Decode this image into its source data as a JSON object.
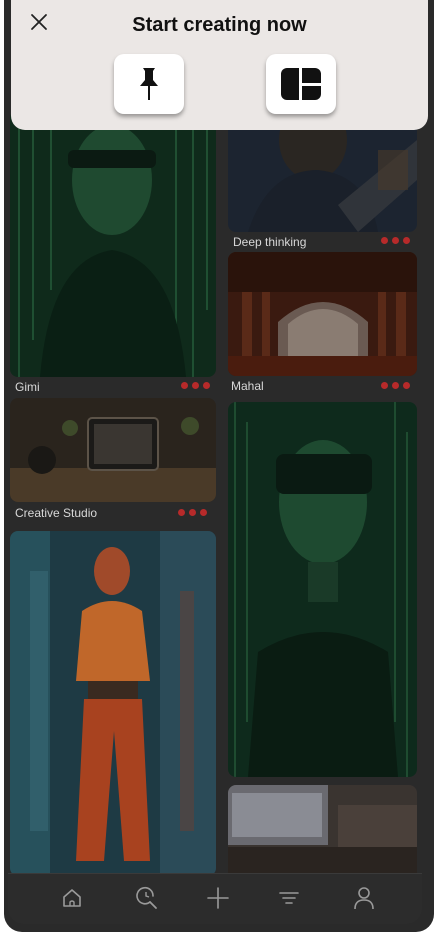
{
  "sheet": {
    "title": "Start creating now",
    "options": [
      {
        "icon": "pin-icon"
      },
      {
        "icon": "board-layout-icon"
      }
    ]
  },
  "feed": {
    "cards": [
      {
        "caption": "Gimi"
      },
      {
        "caption": "Creative Studio"
      },
      {
        "caption": "Deep thinking"
      },
      {
        "caption": "Mahal"
      }
    ]
  },
  "tabbar": {
    "items": [
      {
        "icon": "home-icon"
      },
      {
        "icon": "search-icon"
      },
      {
        "icon": "plus-icon"
      },
      {
        "icon": "filter-icon"
      },
      {
        "icon": "profile-icon"
      }
    ]
  },
  "colors": {
    "sheet_bg": "#ebe7e5",
    "more_dots": "#b72a2a",
    "background": "#2a2a2a"
  }
}
